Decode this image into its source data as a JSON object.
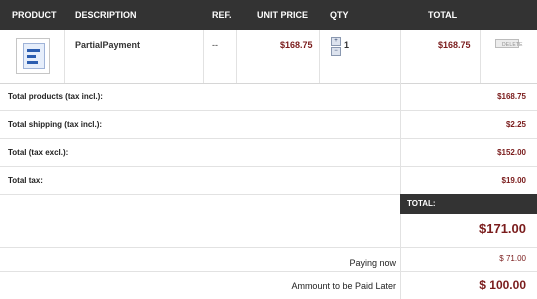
{
  "header": {
    "product": "PRODUCT",
    "description": "DESCRIPTION",
    "ref": "REF.",
    "unit_price": "UNIT PRICE",
    "qty": "QTY",
    "total": "TOTAL"
  },
  "item": {
    "image_icon": "product-thumbnail-icon",
    "name": "PartialPayment",
    "ref": "--",
    "unit_price": "$168.75",
    "quantity": "1",
    "total": "$168.75",
    "delete_label": "DELETE"
  },
  "summary": [
    {
      "label": "Total products (tax incl.):",
      "value": "$168.75"
    },
    {
      "label": "Total shipping (tax incl.):",
      "value": "$2.25"
    },
    {
      "label": "Total (tax excl.):",
      "value": "$152.00"
    },
    {
      "label": "Total tax:",
      "value": "$19.00"
    }
  ],
  "totals": {
    "header": "TOTAL:",
    "grand_total": "$171.00",
    "paying_now_label": "Paying now",
    "paying_now_value": "$ 71.00",
    "pay_later_label": "Ammount to be Paid Later",
    "pay_later_value": "$ 100.00"
  },
  "colors": {
    "header_bg": "#333333",
    "price": "#7a1c1c"
  }
}
